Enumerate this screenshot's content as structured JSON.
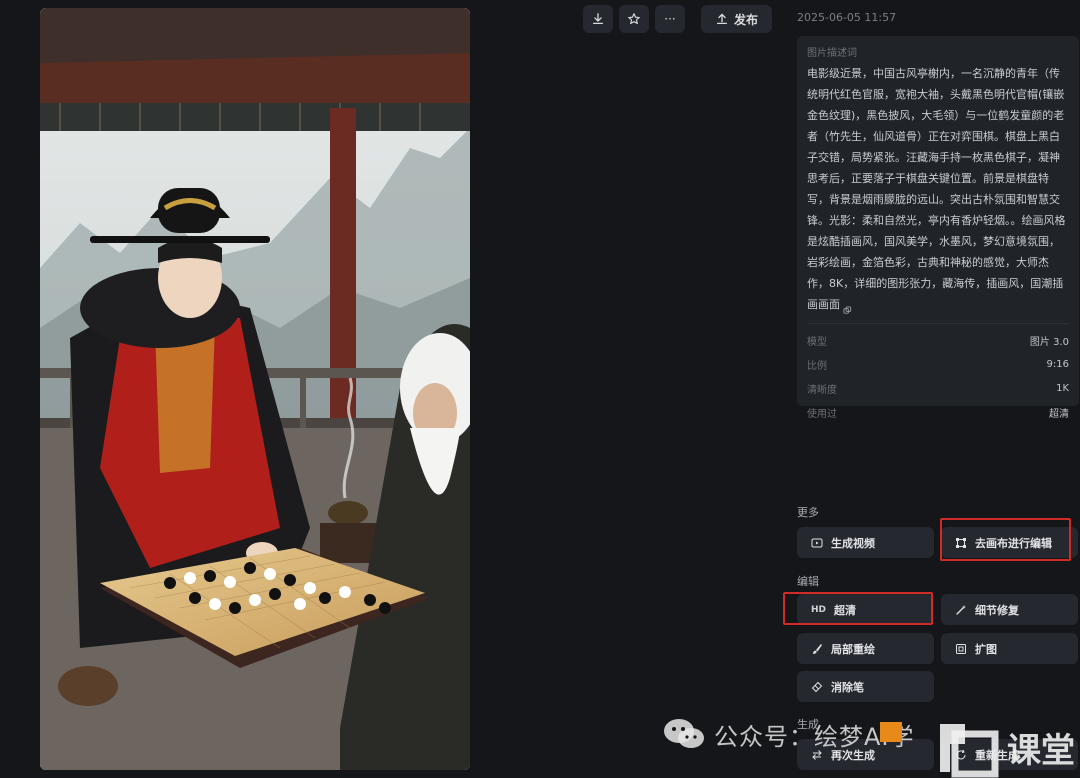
{
  "artwork": {
    "alt_icon": "image-artwork"
  },
  "toolbar": {
    "download_icon": "download-icon",
    "favorite_icon": "star-icon",
    "more_label": "···",
    "publish_label": "发布"
  },
  "timestamp": "2025-06-05 11:57",
  "prompt": {
    "heading": "图片描述词",
    "text": "电影级近景，中国古风亭榭内，一名沉静的青年（传统明代红色官服，宽袍大袖，头戴黑色明代官帽(镶嵌金色纹理)，黑色披风，大毛领）与一位鹤发童颜的老者（竹先生，仙风道骨）正在对弈围棋。棋盘上黑白子交错，局势紧张。汪藏海手持一枚黑色棋子，凝神思考后，正要落子于棋盘关键位置。前景是棋盘特写，背景是烟雨朦胧的远山。突出古朴氛围和智慧交锋。光影：柔和自然光，亭内有香炉轻烟。。绘画风格是炫酷插画风，国风美学，水墨风，梦幻意境氛围，岩彩绘画，金箔色彩，古典和神秘的感觉，大师杰作，8K，详细的图形张力，藏海传，插画风，国潮插画画面"
  },
  "meta": [
    {
      "label": "模型",
      "value": "图片 3.0"
    },
    {
      "label": "比例",
      "value": "9:16"
    },
    {
      "label": "清晰度",
      "value": "1K"
    },
    {
      "label": "使用过",
      "value": "超清"
    }
  ],
  "sections": {
    "more": "更多",
    "edit": "编辑",
    "generate": "生成"
  },
  "actions": {
    "generate_video": "生成视频",
    "canvas_edit": "去画布进行编辑",
    "upscale_prefix": "HD",
    "upscale": "超清",
    "detail_repair": "细节修复",
    "inpaint": "局部重绘",
    "expand": "扩图",
    "eraser": "消除笔",
    "regenerate": "再次生成",
    "regen_all": "重新生成"
  },
  "watermark": {
    "text": "公众号：绘梦AI学",
    "tail": "课堂"
  },
  "colors": {
    "highlight": "#d22a26",
    "background": "#14161a",
    "card": "#202328",
    "button": "#25282e"
  }
}
